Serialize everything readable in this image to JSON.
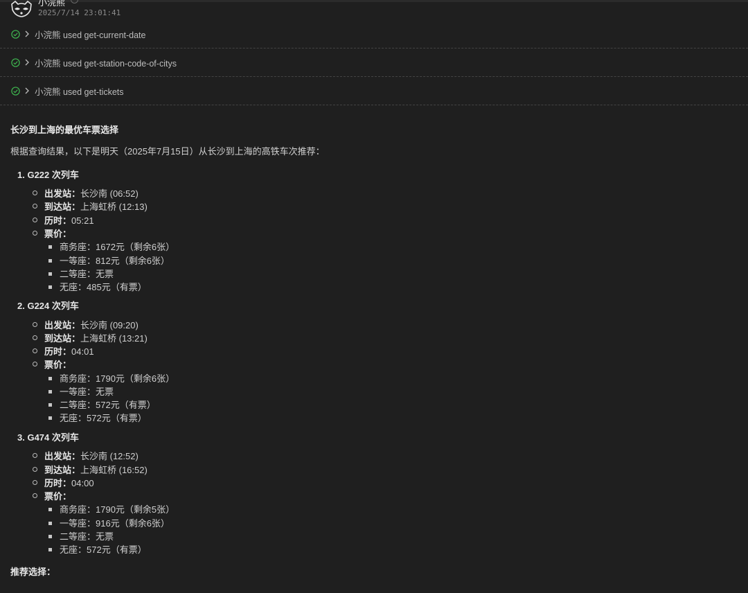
{
  "header": {
    "sender_name": "小浣熊",
    "timestamp": "2025/7/14 23:01:41",
    "avatar_icon": "raccoon-icon"
  },
  "tool_calls": [
    {
      "label": "小浣熊 used get-current-date",
      "status_icon": "check-circle-icon"
    },
    {
      "label": "小浣熊 used get-station-code-of-citys",
      "status_icon": "check-circle-icon"
    },
    {
      "label": "小浣熊 used get-tickets",
      "status_icon": "check-circle-icon"
    }
  ],
  "message": {
    "title": "长沙到上海的最优车票选择",
    "intro": "根据查询结果，以下是明天（2025年7月15日）从长沙到上海的高铁车次推荐：",
    "trains": [
      {
        "title": "1. G222 次列车",
        "departure_label": "出发站：",
        "departure_value": "长沙南 (06:52)",
        "arrival_label": "到达站：",
        "arrival_value": "上海虹桥 (12:13)",
        "duration_label": "历时：",
        "duration_value": "05:21",
        "price_label": "票价：",
        "prices": [
          "商务座：1672元（剩余6张）",
          "一等座：812元（剩余6张）",
          "二等座：无票",
          "无座：485元（有票）"
        ]
      },
      {
        "title": "2. G224 次列车",
        "departure_label": "出发站：",
        "departure_value": "长沙南 (09:20)",
        "arrival_label": "到达站：",
        "arrival_value": "上海虹桥 (13:21)",
        "duration_label": "历时：",
        "duration_value": "04:01",
        "price_label": "票价：",
        "prices": [
          "商务座：1790元（剩余6张）",
          "一等座：无票",
          "二等座：572元（有票）",
          "无座：572元（有票）"
        ]
      },
      {
        "title": "3. G474 次列车",
        "departure_label": "出发站：",
        "departure_value": "长沙南 (12:52)",
        "arrival_label": "到达站：",
        "arrival_value": "上海虹桥 (16:52)",
        "duration_label": "历时：",
        "duration_value": "04:00",
        "price_label": "票价：",
        "prices": [
          "商务座：1790元（剩余5张）",
          "一等座：916元（剩余6张）",
          "二等座：无票",
          "无座：572元（有票）"
        ]
      }
    ],
    "recommendation_title": "推荐选择："
  },
  "colors": {
    "background": "#1f1f1f",
    "success": "#3fb950",
    "divider": "#444444"
  }
}
